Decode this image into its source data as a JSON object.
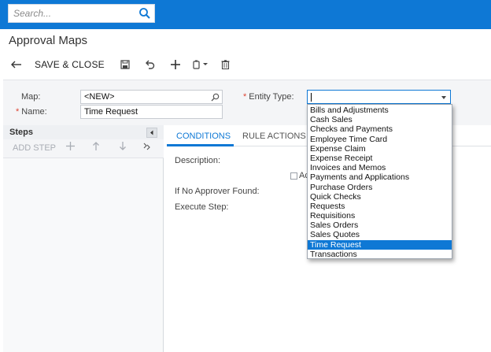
{
  "search": {
    "placeholder": "Search..."
  },
  "page": {
    "title": "Approval Maps"
  },
  "toolbar": {
    "save_close_label": "SAVE & CLOSE"
  },
  "form": {
    "map_label": "Map:",
    "map_value": "<NEW>",
    "name_label": "Name:",
    "name_value": "Time Request",
    "entity_type_label": "Entity Type:",
    "required_marker": "*"
  },
  "steps": {
    "title": "Steps",
    "add_step_label": "ADD STEP"
  },
  "tabs": [
    {
      "label": "CONDITIONS",
      "active": true
    },
    {
      "label": "RULE ACTIONS",
      "active": false
    }
  ],
  "conditions": {
    "description_label": "Description:",
    "checkbox_label_partial": "Ac",
    "if_no_approver_label": "If No Approver Found:",
    "execute_step_label": "Execute Step:"
  },
  "entity_type_dropdown": {
    "value": "",
    "selected_index": 14,
    "options": [
      "Bills and Adjustments",
      "Cash Sales",
      "Checks and Payments",
      "Employee Time Card",
      "Expense Claim",
      "Expense Receipt",
      "Invoices and Memos",
      "Payments and Applications",
      "Purchase Orders",
      "Quick Checks",
      "Requests",
      "Requisitions",
      "Sales Orders",
      "Sales Quotes",
      "Time Request",
      "Transactions"
    ]
  },
  "icons": {
    "search": "search-icon",
    "back": "back-arrow-icon",
    "save": "save-icon",
    "undo": "undo-icon",
    "add": "plus-icon",
    "copy": "copy-icon",
    "delete": "trash-icon",
    "lookup": "magnifier-icon",
    "collapse": "collapse-left-icon"
  },
  "colors": {
    "brand": "#0e78d5",
    "selection": "#0e78d5",
    "required": "#d43333"
  }
}
